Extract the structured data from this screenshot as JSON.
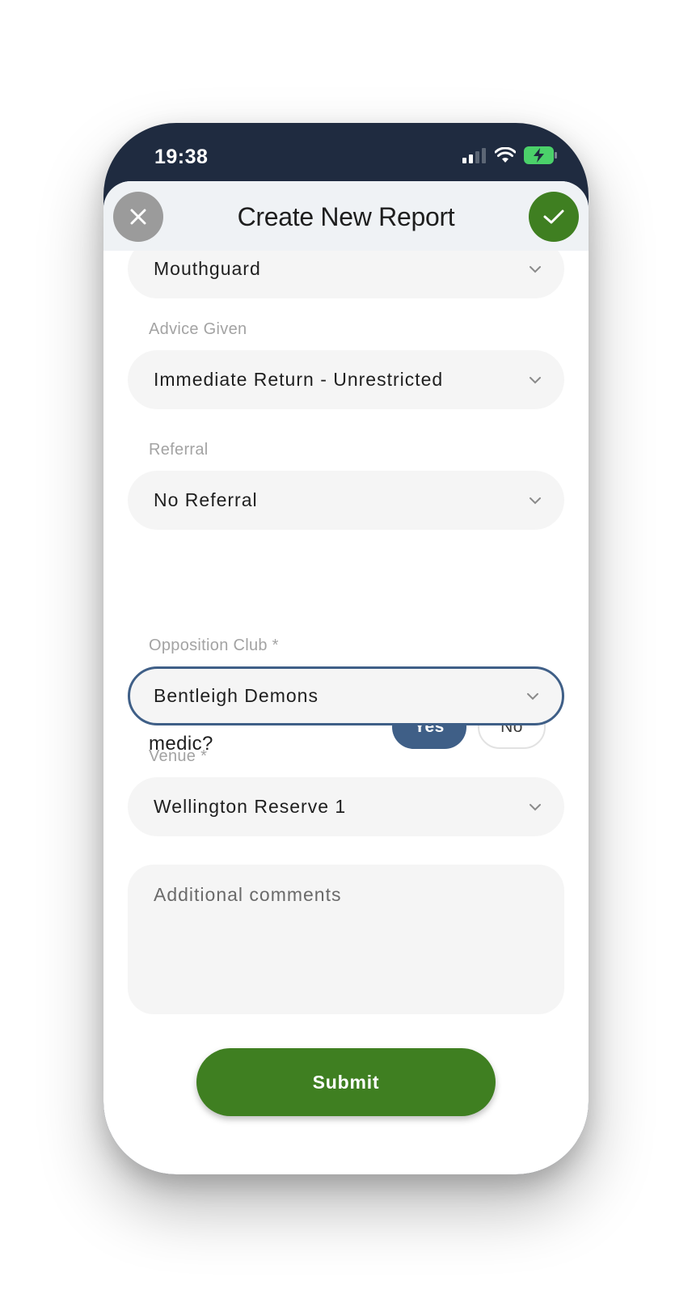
{
  "status_bar": {
    "time": "19:38"
  },
  "header": {
    "title": "Create New Report"
  },
  "fields": {
    "mouthguard": {
      "value": "Mouthguard"
    },
    "advice_given": {
      "label": "Advice Given",
      "value": "Immediate Return - Unrestricted"
    },
    "referral": {
      "label": "Referral",
      "value": "No Referral"
    },
    "ground_medic": {
      "label": "Treated by ground medic?",
      "yes_label": "Yes",
      "no_label": "No",
      "selected": "Yes"
    },
    "opposition_club": {
      "label": "Opposition Club *",
      "value": "Bentleigh Demons"
    },
    "venue": {
      "label": "Venue *",
      "value": "Wellington Reserve 1"
    },
    "comments": {
      "placeholder": "Additional comments"
    }
  },
  "actions": {
    "submit_label": "Submit"
  },
  "colors": {
    "header_bar": "#1f2b40",
    "confirm_green": "#3f7f21",
    "selected_blue": "#3f5f87",
    "close_gray": "#9b9b9b"
  },
  "icons": {
    "close": "close-icon",
    "confirm": "checkmark-icon",
    "dropdown": "chevron-down-icon",
    "signal": "signal-icon",
    "wifi": "wifi-icon",
    "battery": "battery-charging-icon"
  }
}
